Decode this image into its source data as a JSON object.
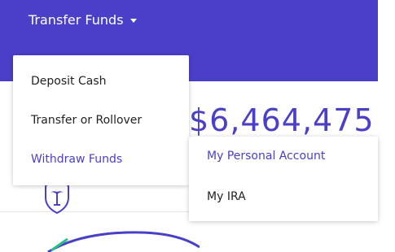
{
  "header": {
    "trigger_label": "Transfer Funds"
  },
  "menu": {
    "items": [
      {
        "label": "Deposit Cash"
      },
      {
        "label": "Transfer or Rollover"
      },
      {
        "label": "Withdraw Funds"
      }
    ]
  },
  "submenu": {
    "items": [
      {
        "label": "My Personal Account"
      },
      {
        "label": "My IRA"
      }
    ]
  },
  "balance": {
    "value": "$6,464,475"
  },
  "balance_sub": {
    "text": "n"
  },
  "colors": {
    "accent": "#4a3fc9",
    "header_bg": "#4a3fc9",
    "text": "#222222"
  },
  "icons": {
    "shield": "palm-tree-shield-icon",
    "caret": "caret-down-icon"
  }
}
